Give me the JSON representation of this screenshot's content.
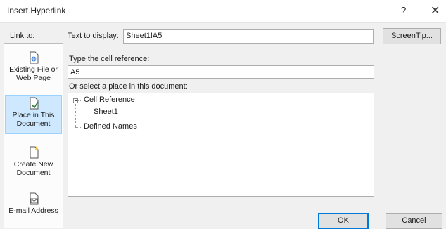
{
  "window": {
    "title": "Insert Hyperlink",
    "help_label": "?",
    "close_label": "✕"
  },
  "link_to": {
    "label": "Link to:",
    "items": [
      {
        "label": "Existing File or Web Page",
        "icon": "existing-file-icon",
        "selected": false
      },
      {
        "label": "Place in This Document",
        "icon": "place-in-document-icon",
        "selected": true
      },
      {
        "label": "Create New Document",
        "icon": "create-new-document-icon",
        "selected": false
      },
      {
        "label": "E-mail Address",
        "icon": "email-address-icon",
        "selected": false
      }
    ]
  },
  "text_to_display": {
    "label": "Text to display:",
    "value": "Sheet1!A5"
  },
  "screentip_label": "ScreenTip...",
  "cell_reference": {
    "label": "Type the cell reference:",
    "value": "A5"
  },
  "place_select": {
    "label": "Or select a place in this document:",
    "tree": [
      {
        "label": "Cell Reference",
        "expanded": true,
        "children": [
          {
            "label": "Sheet1"
          }
        ]
      },
      {
        "label": "Defined Names"
      }
    ]
  },
  "buttons": {
    "ok": "OK",
    "cancel": "Cancel"
  },
  "colors": {
    "selected_bg": "#cde8ff",
    "selected_border": "#99d1ff",
    "primary_border": "#0078d7"
  }
}
